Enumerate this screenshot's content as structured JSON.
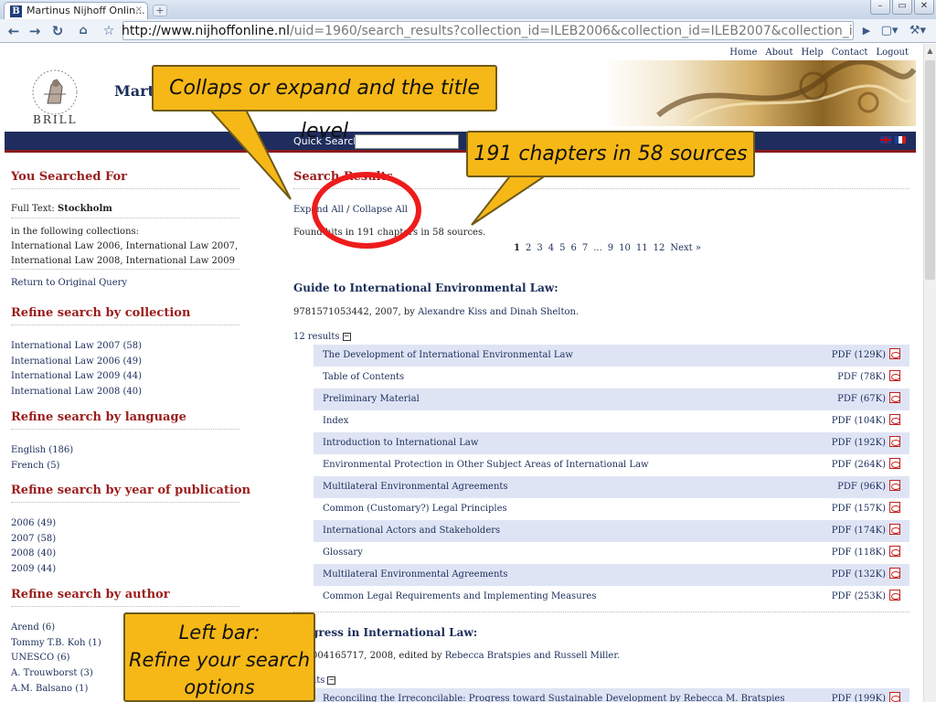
{
  "browser": {
    "tab_title": "Martinus Nijhoff Onlin...",
    "favicon_letter": "B",
    "tab_close": "×",
    "new_tab": "+",
    "url_host": "http://www.nijhoffonline.nl",
    "url_path": "/uid=1960/search_results?collection_id=ILEB2006&collection_id=ILEB2007&collection_id=ILEB2008&collec",
    "window_buttons": [
      "–",
      "▭",
      "✕"
    ]
  },
  "site": {
    "brand": "BRILL",
    "name": "Martinus Nijhoff",
    "top_links": [
      "Home",
      "About",
      "Help",
      "Contact",
      "Logout"
    ],
    "quick_search_label": "Quick Search",
    "quick_search_value": ""
  },
  "left": {
    "you_searched": {
      "heading": "You Searched For",
      "full_text_label": "Full Text:",
      "full_text_value": "Stockholm",
      "collections_intro": "in the following collections:",
      "collections_line1": "International Law 2006, International Law 2007,",
      "collections_line2": "International Law 2008, International Law 2009",
      "return_link": "Return to Original Query"
    },
    "refine_collection": {
      "heading": "Refine search by collection",
      "items": [
        "International Law 2007 (58)",
        "International Law 2006 (49)",
        "International Law 2009 (44)",
        "International Law 2008 (40)"
      ]
    },
    "refine_language": {
      "heading": "Refine search by language",
      "items": [
        "English (186)",
        "French (5)"
      ]
    },
    "refine_year": {
      "heading": "Refine search by year of publication",
      "items": [
        "2006 (49)",
        "2007 (58)",
        "2008 (40)",
        "2009 (44)"
      ]
    },
    "refine_author": {
      "heading": "Refine search by author",
      "items": [
        "Arend (6)",
        "Tommy T.B. Koh (1)",
        "UNESCO (6)",
        "A. Trouwborst (3)",
        "A.M. Balsano (1)"
      ]
    }
  },
  "main": {
    "heading": "Search Results",
    "expand_all": "Expand All",
    "separator": "/",
    "collapse_all": "Collapse All",
    "found_text": "Found hits in 191 chapters in 58 sources.",
    "pager": {
      "current": "1",
      "pages": [
        "2",
        "3",
        "4",
        "5",
        "6",
        "7",
        "...",
        "9",
        "10",
        "11",
        "12"
      ],
      "next": "Next »"
    },
    "sources": [
      {
        "title": "Guide to International Environmental Law:",
        "meta_prefix": "9781571053442, 2007, by ",
        "authors": "Alexandre Kiss and Dinah Shelton.",
        "results_label": "12 results",
        "toggle": "−",
        "chapters": [
          {
            "title": "The Development of International Environmental Law",
            "pdf": "PDF (129K)"
          },
          {
            "title": "Table of Contents",
            "pdf": "PDF (78K)"
          },
          {
            "title": "Preliminary Material",
            "pdf": "PDF (67K)"
          },
          {
            "title": "Index",
            "pdf": "PDF (104K)"
          },
          {
            "title": "Introduction to International Law",
            "pdf": "PDF (192K)"
          },
          {
            "title": "Environmental Protection in Other Subject Areas of International Law",
            "pdf": "PDF (264K)"
          },
          {
            "title": "Multilateral Environmental Agreements",
            "pdf": "PDF (96K)"
          },
          {
            "title": "Common (Customary?) Legal Principles",
            "pdf": "PDF (157K)"
          },
          {
            "title": "International Actors and Stakeholders",
            "pdf": "PDF (174K)"
          },
          {
            "title": "Glossary",
            "pdf": "PDF (118K)"
          },
          {
            "title": "Multilateral Environmental Agreements",
            "pdf": "PDF (132K)"
          },
          {
            "title": "Common Legal Requirements and Implementing Measures",
            "pdf": "PDF (253K)"
          }
        ]
      },
      {
        "title": "gress in International Law:",
        "meta_prefix": "004165717, 2008, edited by ",
        "authors": "Rebecca Bratspies and Russell Miller.",
        "results_label": "lts",
        "toggle": "−",
        "chapters": [
          {
            "title": "Reconciling the Irreconcilable: Progress toward Sustainable Development by Rebecca M. Bratspies",
            "pdf": "PDF (199K)"
          }
        ]
      }
    ]
  },
  "callouts": {
    "collapse": "Collaps or expand and the title level",
    "chapters": "191 chapters in 58 sources",
    "leftbar_line1": "Left bar:",
    "leftbar_line2": "Refine your search",
    "leftbar_line3": "options"
  },
  "colors": {
    "accent_red": "#9b1c1c",
    "navy": "#1e2d5d",
    "callout_yellow": "#f6b817",
    "ring_red": "#ee1c1c"
  }
}
